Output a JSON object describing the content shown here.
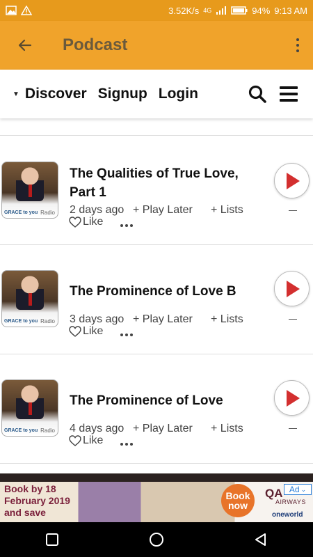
{
  "status": {
    "net_speed": "3.52K/s",
    "network": "4G",
    "battery": "94%",
    "time": "9:13 AM"
  },
  "app_bar": {
    "title": "Podcast"
  },
  "nav": {
    "items": [
      "Discover",
      "Signup",
      "Login"
    ]
  },
  "episodes": [
    {
      "title": "The Qualities of True Love, Part 1",
      "age": "2 days ago",
      "play_later": "+ Play Later",
      "lists": "+ Lists",
      "like": "Like",
      "thumb_brand": "GRACE to you",
      "thumb_label": "Radio"
    },
    {
      "title": "The Prominence of Love B",
      "age": "3 days ago",
      "play_later": "+ Play Later",
      "lists": "+ Lists",
      "like": "Like",
      "thumb_brand": "GRACE to you",
      "thumb_label": "Radio"
    },
    {
      "title": "The Prominence of Love",
      "age": "4 days ago",
      "play_later": "+ Play Later",
      "lists": "+ Lists",
      "like": "Like",
      "thumb_brand": "GRACE to you",
      "thumb_label": "Radio"
    }
  ],
  "ad": {
    "promo": "Book by 18 February 2019 and save",
    "cta": "Book now",
    "brand": "QA",
    "brand_sub": "AIRWAYS",
    "alliance": "oneworld",
    "badge": "Ad"
  },
  "colors": {
    "status_bar": "#e79a1c",
    "app_bar": "#f0a32b",
    "title_text": "#6b5a3c",
    "play_triangle": "#d32f2f"
  },
  "icons": [
    "back-arrow-icon",
    "overflow-menu-icon",
    "search-icon",
    "hamburger-menu-icon",
    "heart-icon",
    "play-icon",
    "more-dots-icon",
    "nav-back-icon",
    "nav-home-icon",
    "nav-recents-icon"
  ]
}
